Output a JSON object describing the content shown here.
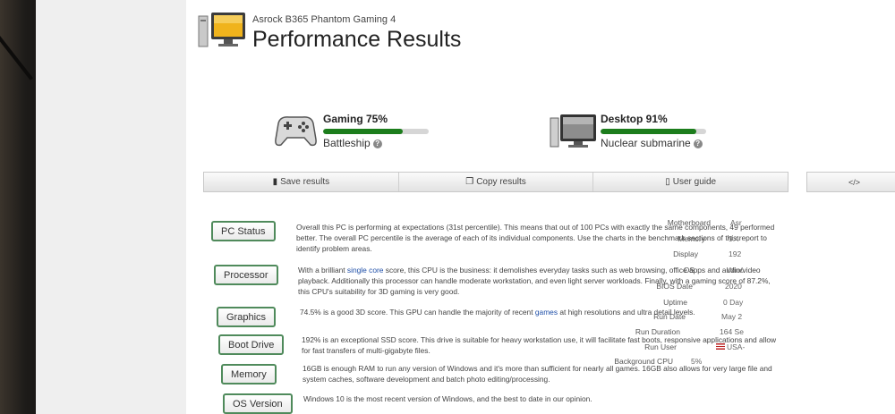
{
  "header": {
    "subtitle": "Asrock B365 Phantom Gaming 4",
    "title": "Performance Results"
  },
  "summaries": [
    {
      "label": "Gaming 75%",
      "level_percent": 75,
      "sub": "Battleship",
      "icon": "gamepad-icon"
    },
    {
      "label": "Desktop 91%",
      "level_percent": 91,
      "sub": "Nuclear submarine",
      "icon": "desktop-monitor-icon"
    }
  ],
  "actions": {
    "save": "Save results",
    "copy": "Copy results",
    "guide": "User guide",
    "embed": "</>"
  },
  "categories": {
    "pc_status": {
      "label": "PC Status",
      "text": "Overall this PC is performing at expectations (31st percentile). This means that out of 100 PCs with exactly the same components, 49 performed better. The overall PC percentile is the average of each of its individual components. Use the charts in the benchmark sections of this report to identify problem areas."
    },
    "processor": {
      "label": "Processor",
      "text_a": "With a brilliant ",
      "highlight": "single core",
      "text_b": " score, this CPU is the business: it demolishes everyday tasks such as web browsing, office apps and audio/video playback. Additionally this processor can handle moderate workstation, and even light server workloads. Finally, with a gaming score of 87.2%, this CPU's suitability for 3D gaming is very good."
    },
    "graphics": {
      "label": "Graphics",
      "text_a": "74.5% is a good 3D score. This GPU can handle the majority of recent ",
      "highlight": "games",
      "text_b": " at high resolutions and ultra detail levels."
    },
    "boot_drive": {
      "label": "Boot Drive",
      "text": "192% is an exceptional SSD score. This drive is suitable for heavy workstation use, it will facilitate fast boots, responsive applications and allow for fast transfers of multi-gigabyte files."
    },
    "memory": {
      "label": "Memory",
      "text": "16GB is enough RAM to run any version of Windows and it's more than sufficient for nearly all games. 16GB also allows for very large file and system caches, software development and batch photo editing/processing."
    },
    "os_version": {
      "label": "OS Version",
      "text": "Windows 10 is the most recent version of Windows, and the best to date in our opinion."
    }
  },
  "system_info": [
    {
      "key": "Motherboard",
      "value": "Asr"
    },
    {
      "key": "Memory",
      "value": "9.4"
    },
    {
      "key": "Display",
      "value": "192"
    },
    {
      "key": "OS",
      "value": "Winc"
    },
    {
      "key": "BIOS Date",
      "value": "2020"
    },
    {
      "key": "Uptime",
      "value": "0 Day"
    },
    {
      "key": "Run Date",
      "value": "May 2"
    },
    {
      "key": "Run Duration",
      "value": "164 Se"
    },
    {
      "key": "Run User",
      "value": "USA-"
    },
    {
      "key": "Background CPU",
      "value": "5%"
    }
  ]
}
